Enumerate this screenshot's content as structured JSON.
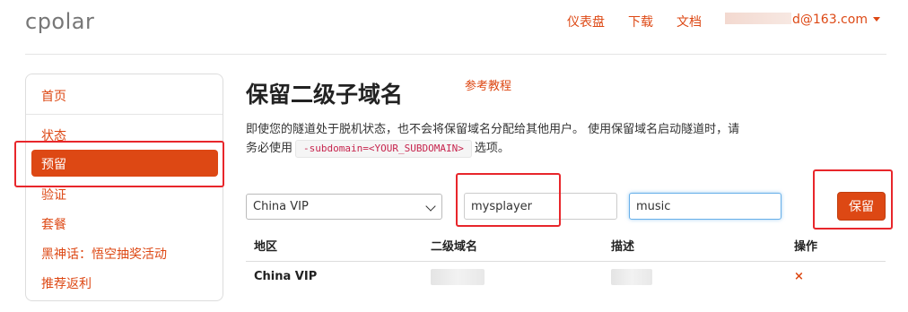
{
  "header": {
    "brand": "cpolar",
    "nav": [
      "仪表盘",
      "下载",
      "文档"
    ],
    "user_visible_text": "d@163.com"
  },
  "sidebar": {
    "items": [
      {
        "label": "首页",
        "active": false
      },
      {
        "label": "状态",
        "active": false
      },
      {
        "label": "预留",
        "active": true
      },
      {
        "label": "验证",
        "active": false
      },
      {
        "label": "套餐",
        "active": false
      },
      {
        "label": "黑神话：悟空抽奖活动",
        "active": false
      },
      {
        "label": "推荐返利",
        "active": false
      }
    ]
  },
  "main": {
    "title": "保留二级子域名",
    "tutorial_link": "参考教程",
    "description_before": "即使您的隧道处于脱机状态，也不会将保留域名分配给其他用户。 使用保留域名启动隧道时，请务必使用",
    "description_code": "-subdomain=<YOUR_SUBDOMAIN>",
    "description_after": "选项。"
  },
  "form": {
    "region_selected": "China VIP",
    "subdomain_value": "mysplayer",
    "description_value": "music",
    "save_label": "保留"
  },
  "table": {
    "headers": [
      "地区",
      "二级域名",
      "描述",
      "操作"
    ],
    "rows": [
      {
        "region": "China VIP",
        "action": "×"
      }
    ]
  },
  "colors": {
    "accent": "#dd4814",
    "annotation": "#e8262b"
  }
}
